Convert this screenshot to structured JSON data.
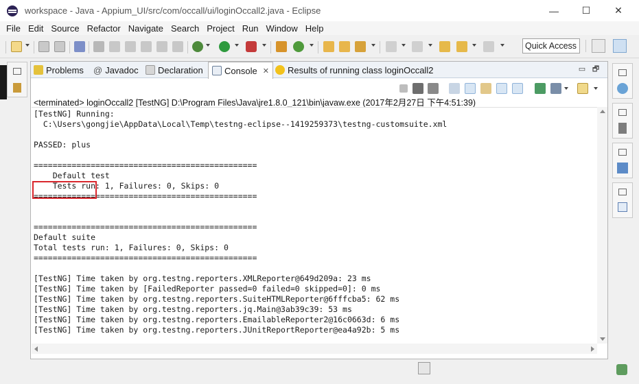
{
  "window": {
    "title": "workspace - Java - Appium_UI/src/com/occall/ui/loginOccall2.java - Eclipse",
    "minimize_glyph": "—",
    "maximize_glyph": "☐",
    "close_glyph": "✕"
  },
  "menu": [
    "File",
    "Edit",
    "Source",
    "Refactor",
    "Navigate",
    "Search",
    "Project",
    "Run",
    "Window",
    "Help"
  ],
  "toolbar": {
    "quick_access": "Quick Access"
  },
  "tabs": [
    {
      "label": "Problems",
      "icon": "problems-icon"
    },
    {
      "label": "Javadoc",
      "icon": "javadoc-icon",
      "prefix": "@"
    },
    {
      "label": "Declaration",
      "icon": "declaration-icon"
    },
    {
      "label": "Console",
      "icon": "console-icon",
      "close": "✕"
    },
    {
      "label": "Results of running class loginOccall2",
      "icon": "testng-icon"
    }
  ],
  "view_controls": {
    "minimize": "▭",
    "maximize": "🗗"
  },
  "console": {
    "status": "<terminated> loginOccall2 [TestNG] D:\\Program Files\\Java\\jre1.8.0_121\\bin\\javaw.exe (2017年2月27日 下午4:51:39)",
    "lines": [
      "[TestNG] Running:",
      "  C:\\Users\\gongjie\\AppData\\Local\\Temp\\testng-eclipse--1419259373\\testng-customsuite.xml",
      "",
      "PASSED: plus",
      "",
      "===============================================",
      "    Default test",
      "    Tests run: 1, Failures: 0, Skips: 0",
      "===============================================",
      "",
      "",
      "===============================================",
      "Default suite",
      "Total tests run: 1, Failures: 0, Skips: 0",
      "===============================================",
      "",
      "[TestNG] Time taken by org.testng.reporters.XMLReporter@649d209a: 23 ms",
      "[TestNG] Time taken by [FailedReporter passed=0 failed=0 skipped=0]: 0 ms",
      "[TestNG] Time taken by org.testng.reporters.SuiteHTMLReporter@6fffcba5: 62 ms",
      "[TestNG] Time taken by org.testng.reporters.jq.Main@3ab39c39: 53 ms",
      "[TestNG] Time taken by org.testng.reporters.EmailableReporter2@16c0663d: 6 ms",
      "[TestNG] Time taken by org.testng.reporters.JUnitReportReporter@ea4a92b: 5 ms"
    ]
  },
  "colors": {
    "highlight_border": "#d9262c",
    "tabbar_bg": "#eef2f7"
  }
}
